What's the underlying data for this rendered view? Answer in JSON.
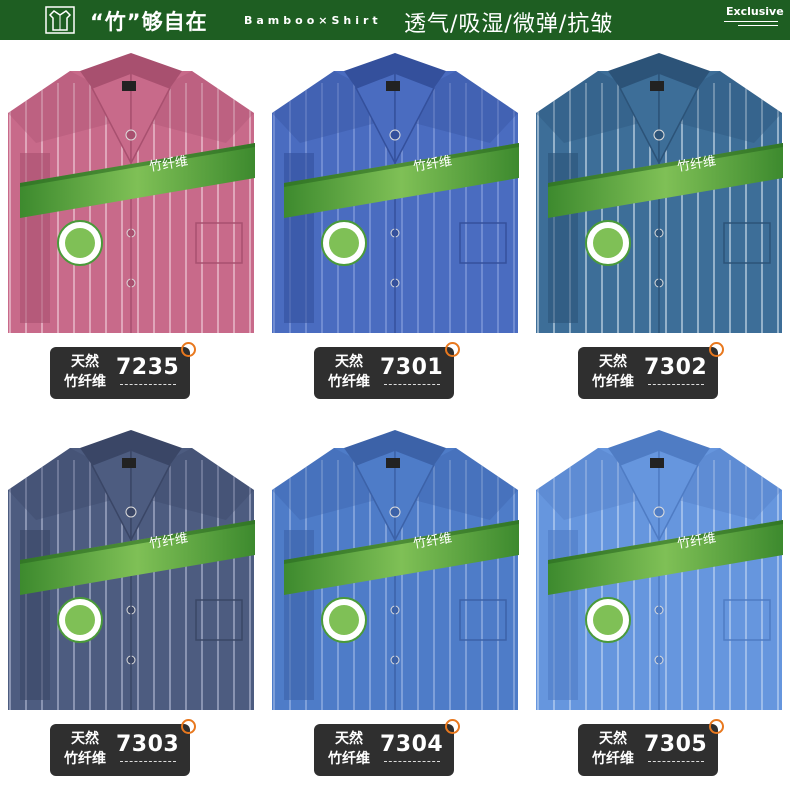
{
  "banner": {
    "title": "“竹”够自在",
    "brand": "Bamboo×Shirt",
    "features": "透气/吸湿/微弹/抗皱",
    "exclusive": "Exclusive"
  },
  "band_label": "竹纤维",
  "products": [
    {
      "kind_line1": "天然",
      "kind_line2": "竹纤维",
      "code": "7235",
      "color": "#c86a8a",
      "dark": "#a8506f",
      "stripe": "#f3d6e0"
    },
    {
      "kind_line1": "天然",
      "kind_line2": "竹纤维",
      "code": "7301",
      "color": "#4a6cc0",
      "dark": "#34509c",
      "stripe": "#8fa6e0"
    },
    {
      "kind_line1": "天然",
      "kind_line2": "竹纤维",
      "code": "7302",
      "color": "#3d6e98",
      "dark": "#2c5378",
      "stripe": "#d9e6f2"
    },
    {
      "kind_line1": "天然",
      "kind_line2": "竹纤维",
      "code": "7303",
      "color": "#4d5c80",
      "dark": "#3a4666",
      "stripe": "#b9c2da"
    },
    {
      "kind_line1": "天然",
      "kind_line2": "竹纤维",
      "code": "7304",
      "color": "#4e7cc8",
      "dark": "#3c62a8",
      "stripe": "#a4bde8"
    },
    {
      "kind_line1": "天然",
      "kind_line2": "竹纤维",
      "code": "7305",
      "color": "#6696de",
      "dark": "#4f7cc4",
      "stripe": "#c8daf5"
    }
  ]
}
